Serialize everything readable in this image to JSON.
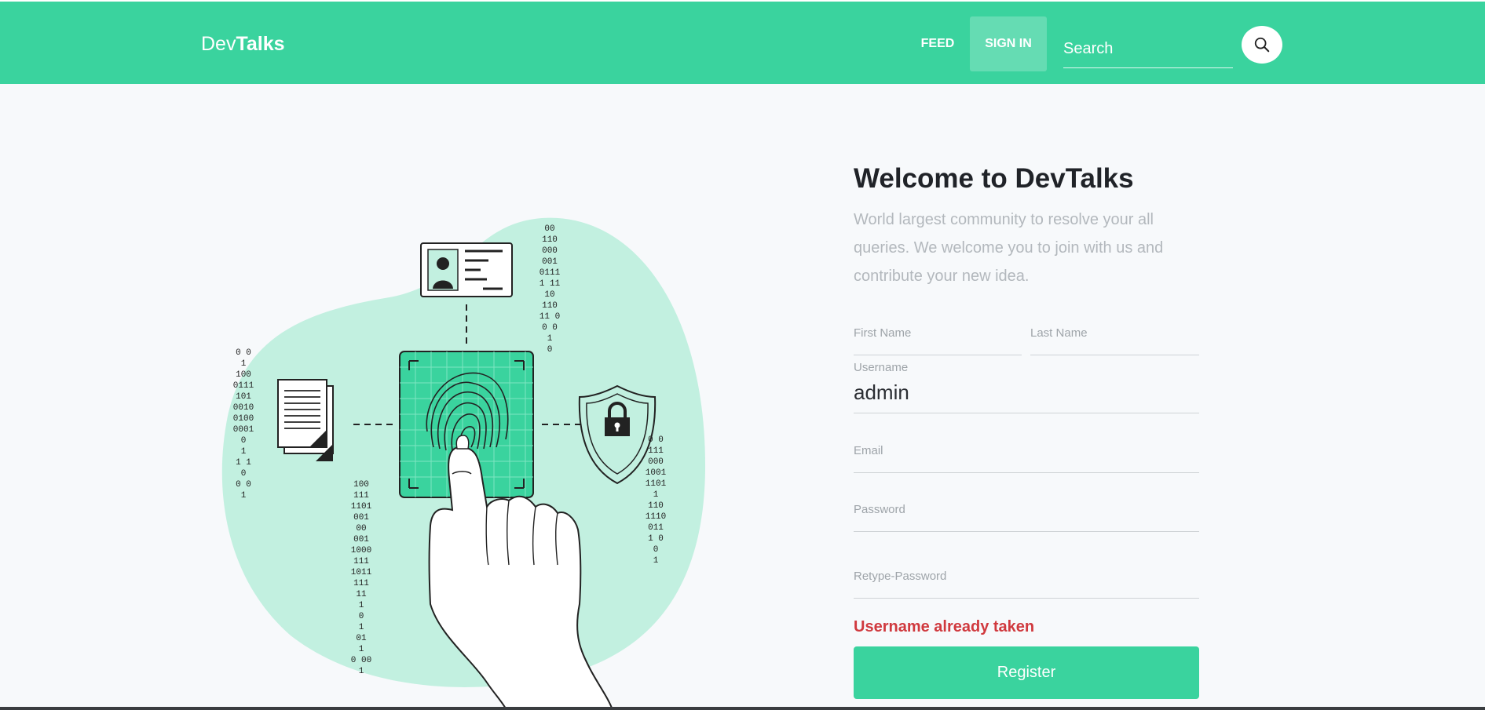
{
  "brand": {
    "prefix": "Dev",
    "bold": "Talks"
  },
  "nav": {
    "feed": "FEED",
    "signin": "SIGN IN"
  },
  "search": {
    "placeholder": "Search"
  },
  "form": {
    "title": "Welcome to DevTalks",
    "subtitle": "World largest community to resolve your all queries. We welcome you to join with us and contribute your new idea.",
    "first_name_label": "First Name",
    "last_name_label": "Last Name",
    "username_label": "Username",
    "username_value": "admin",
    "email_label": "Email",
    "password_label": "Password",
    "retype_password_label": "Retype-Password",
    "error": "Username already taken",
    "register_label": "Register"
  },
  "colors": {
    "accent": "#3ad39e",
    "error": "#d0393e",
    "blob": "#c2f0e0"
  },
  "illustration": {
    "binary_strings": [
      "00",
      "110",
      "000",
      "001",
      "0111",
      "1 11",
      "10",
      "110",
      "11 0",
      "0 0",
      "1",
      "0",
      "0 0",
      "1",
      "100",
      "0111",
      "101",
      "0010",
      "0100",
      "0001",
      "0",
      "1",
      "1 1",
      "0",
      "0 0",
      "1",
      "100",
      "111",
      "1101",
      "001",
      "00",
      "001",
      "1000",
      "111",
      "1011",
      "111",
      "11",
      "1",
      "0",
      "1",
      "01",
      "1",
      "0 00",
      "1",
      "0 0",
      "111",
      "000",
      "1001",
      "1101",
      "1",
      "110",
      "1110",
      "011",
      "1 0",
      "0",
      "1"
    ]
  }
}
